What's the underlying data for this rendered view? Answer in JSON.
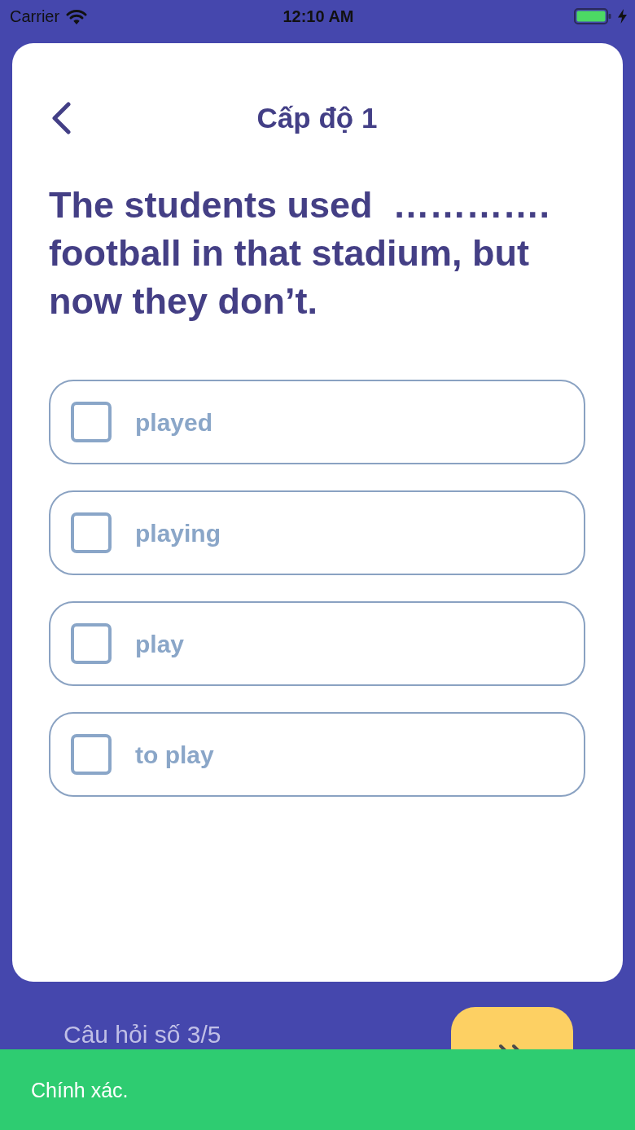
{
  "status_bar": {
    "carrier": "Carrier",
    "time": "12:10 AM"
  },
  "header": {
    "title": "Cấp độ 1"
  },
  "question": "The students used  …………. football in that stadium, but now they don’t.",
  "options": [
    {
      "label": "played",
      "checked": false
    },
    {
      "label": "playing",
      "checked": false
    },
    {
      "label": "play",
      "checked": false
    },
    {
      "label": "to play",
      "checked": false
    }
  ],
  "footer": {
    "progress": "Câu hỏi số 3/5"
  },
  "toast": {
    "kind": "success",
    "message": "Chính xác."
  }
}
